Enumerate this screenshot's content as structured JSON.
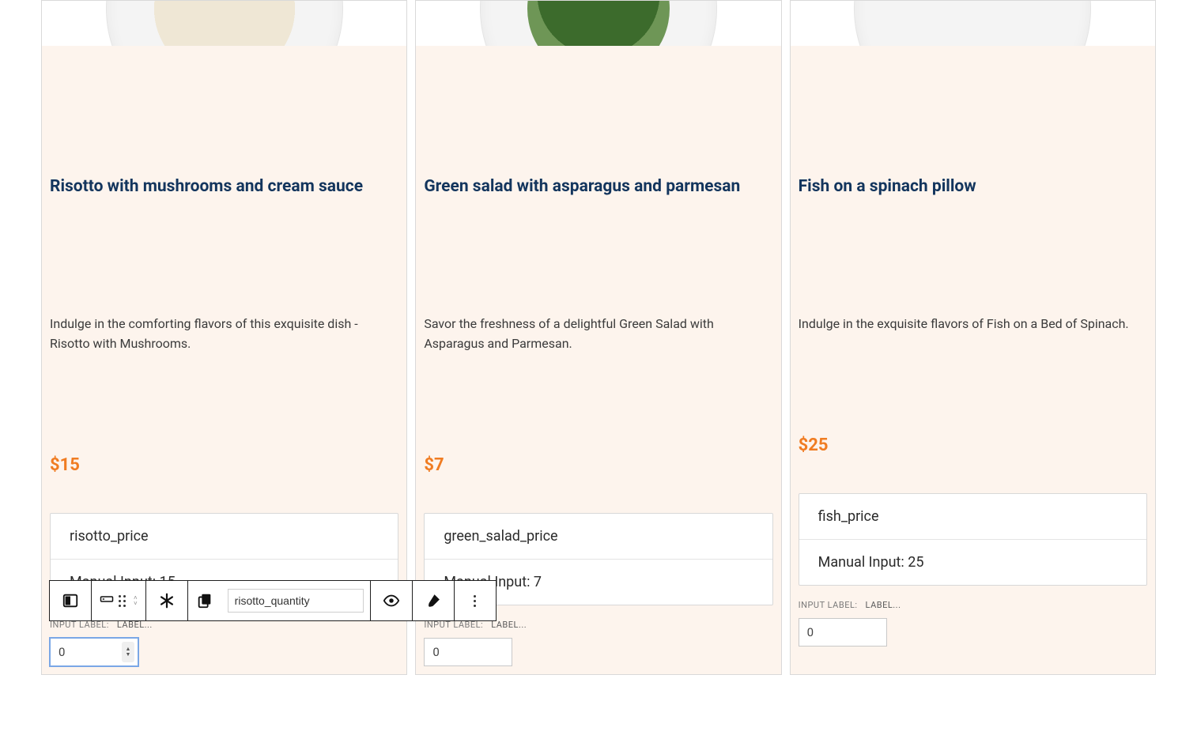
{
  "cards": [
    {
      "title": "Risotto with mushrooms and cream sauce",
      "description": "Indulge in the comforting flavors of this exquisite dish - Risotto with Mushrooms.",
      "price": "$15",
      "var_name": "risotto_price",
      "manual_input": "Manual Input: 15",
      "input_label_caption": "INPUT LABEL:",
      "input_label_value": "LABEL...",
      "qty_value": "0"
    },
    {
      "title": "Green salad with asparagus and parmesan",
      "description": "Savor the freshness of a delightful Green Salad with Asparagus and Parmesan.",
      "price": "$7",
      "var_name": "green_salad_price",
      "manual_input": "Manual Input: 7",
      "input_label_caption": "INPUT LABEL:",
      "input_label_value": "LABEL...",
      "qty_value": "0"
    },
    {
      "title": "Fish on a spinach pillow",
      "description": "Indulge in the exquisite flavors of Fish on a Bed of Spinach.",
      "price": "$25",
      "var_name": "fish_price",
      "manual_input": "Manual Input: 25",
      "input_label_caption": "INPUT LABEL:",
      "input_label_value": "LABEL...",
      "qty_value": "0"
    }
  ],
  "toolbar": {
    "reference_value": "risotto_quantity"
  }
}
